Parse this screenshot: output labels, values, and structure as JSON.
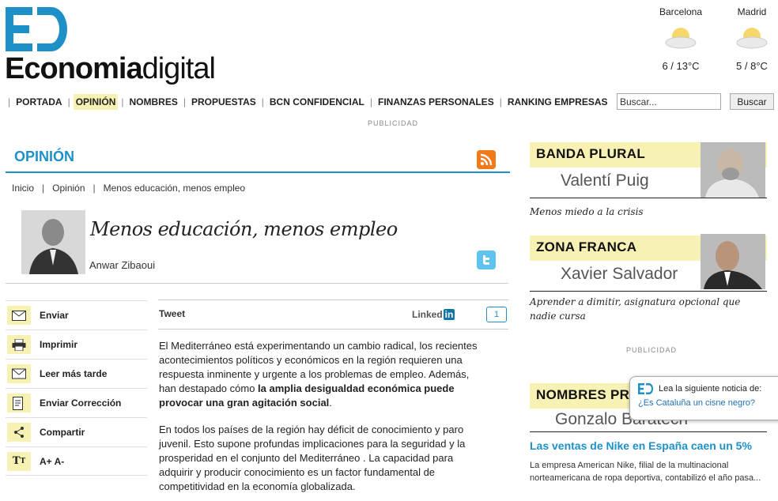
{
  "brand": {
    "logo_bold": "Economia",
    "logo_light": "digital",
    "color": "#1e90c8"
  },
  "weather": [
    {
      "city": "Barcelona",
      "temp": "6 / 13°C",
      "icon": "sun-cloud-icon"
    },
    {
      "city": "Madrid",
      "temp": "5 / 8°C",
      "icon": "sun-cloud-icon"
    }
  ],
  "nav": {
    "items": [
      "PORTADA",
      "OPINIÓN",
      "NOMBRES",
      "PROPUESTAS",
      "BCN CONFIDENCIAL",
      "FINANZAS PERSONALES",
      "RANKING EMPRESAS"
    ],
    "active": "OPINIÓN"
  },
  "search": {
    "placeholder": "Buscar...",
    "button": "Buscar"
  },
  "ad_label": "PUBLICIDAD",
  "section": {
    "title": "OPINIÓN"
  },
  "breadcrumb": [
    "Inicio",
    "Opinión",
    "Menos educación, menos empleo"
  ],
  "article": {
    "title": "Menos educación, menos empleo",
    "author": "Anwar Zibaoui",
    "paragraph1_a": "El Mediterráneo está experimentando un cambio radical, los recientes acontecimientos políticos y económicos en la región requieren una respuesta inminente y urgente a los problemas de empleo. Además, han destapado cómo ",
    "paragraph1_bold": "la amplia desigualdad económica puede provocar una gran agitación social",
    "paragraph1_end": ".",
    "paragraph2": "En todos los países de la región hay déficit de conocimiento y paro juvenil. Esto supone profundas implicaciones para la seguridad y la prosperidad en el conjunto del Mediterráneo . La capacidad para adquirir y producir conocimiento es un factor fundamental de competitividad en la economía globalizada."
  },
  "share": {
    "tweet": "Tweet",
    "linkedin": "Linked",
    "linkedin_in": "in",
    "comments": "1"
  },
  "tools": [
    {
      "label": "Enviar",
      "icon": "envelope-icon"
    },
    {
      "label": "Imprimir",
      "icon": "printer-icon"
    },
    {
      "label": "Leer más tarde",
      "icon": "mail-later-icon"
    },
    {
      "label": "Enviar Corrección",
      "icon": "document-edit-icon"
    },
    {
      "label": "Compartir",
      "icon": "share-icon"
    },
    {
      "label": "A+  A-",
      "icon": "text-size-icon"
    }
  ],
  "columns": [
    {
      "banner": "BANDA PLURAL",
      "name": "Valentí Puig",
      "caption": "Menos miedo a la crisis"
    },
    {
      "banner": "ZONA FRANCA",
      "name": "Xavier Salvador",
      "caption": "Aprender a dimitir, asignatura opcional que nadie cursa"
    },
    {
      "banner": "NOMBRES PRO",
      "name": "Gonzalo Baratech",
      "caption": ""
    }
  ],
  "news": {
    "title": "Las ventas de Nike en España caen un 5%",
    "text": "La empresa American Nike, filial de la multinacional norteamericana de ropa deportiva, contabilizó el año pasa..."
  },
  "popup": {
    "lead": "Lea la siguiente noticia de:",
    "link": "¿Es Cataluña un cisne negro?"
  }
}
